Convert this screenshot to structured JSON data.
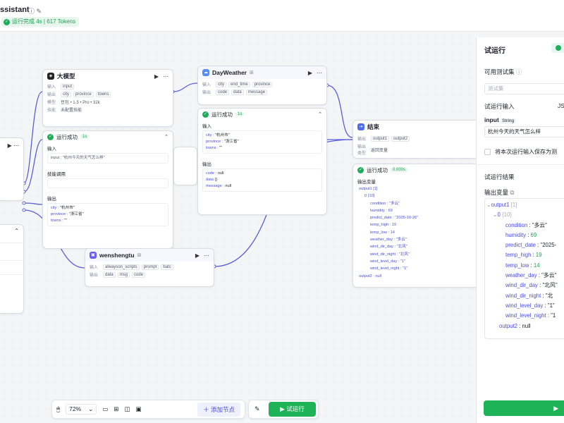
{
  "header": {
    "title": "ssistant",
    "status": "运行完成 4s | 617 Tokens"
  },
  "nodes": {
    "llm": {
      "title": "大模型",
      "input_label": "输入",
      "input": "input",
      "output_label": "输出",
      "outputs": [
        "city",
        "province",
        "towns"
      ],
      "model_label": "模型",
      "model": "豆包 • 1.5 • Pro • 32k",
      "skill_label": "技能",
      "skill": "未配置技能"
    },
    "llm_result": {
      "title": "运行成功",
      "badge": "1s",
      "input_label": "输入",
      "input_line": "input : \"杭州今天的天气怎么样\"",
      "skill_label": "技能调用",
      "output_label": "输出",
      "out": [
        {
          "k": "city",
          "v": "\"杭州市\""
        },
        {
          "k": "province",
          "v": "\"浙江省\""
        },
        {
          "k": "towns",
          "v": "\"\""
        }
      ]
    },
    "weather": {
      "title": "DayWeather",
      "input_label": "输入",
      "inputs": [
        "city",
        "end_time",
        "province"
      ],
      "output_label": "输出",
      "outputs": [
        "code",
        "data",
        "message"
      ]
    },
    "weather_result": {
      "title": "运行成功",
      "badge": "1s",
      "input_label": "输入",
      "in": [
        {
          "k": "city",
          "v": "\"杭州市\""
        },
        {
          "k": "province",
          "v": "\"浙江省\""
        },
        {
          "k": "towns",
          "v": "\"\""
        }
      ],
      "output_label": "输出",
      "out": [
        {
          "k": "code",
          "v": "null"
        },
        {
          "k": "data",
          "v": "{}"
        },
        {
          "k": "message",
          "v": "null"
        }
      ]
    },
    "end": {
      "title": "结束",
      "output_label": "输出",
      "outputs": [
        "output1",
        "output2"
      ],
      "answer_label": "输出类型",
      "answer": "返回变量"
    },
    "end_result": {
      "title": "运行成功",
      "badge": "0.000s",
      "section": "输出变量",
      "lines": [
        "output1 [1]",
        "0 {10}",
        "condition : \"多云\"",
        "humidity : 69",
        "predict_date : \"2025-10-26\"",
        "temp_high : 19",
        "temp_low : 14",
        "weather_day : \"多云\"",
        "wind_dir_day : \"北风\"",
        "wind_dir_night : \"北风\"",
        "wind_level_day : \"1\"",
        "wind_level_night : \"1\"",
        "output2 : null"
      ]
    },
    "wensheng": {
      "title": "wenshengtu",
      "input_label": "输入",
      "inputs": [
        "alwayson_scripts",
        "prompt",
        "batc"
      ],
      "output_label": "输出",
      "outputs": [
        "data",
        "msg",
        "code"
      ]
    }
  },
  "panel": {
    "title": "试运行",
    "testset_label": "可用测试集",
    "testset_placeholder": "测试集",
    "input_section": "试运行输入",
    "input_section_right": "JS",
    "input_name": "input",
    "input_type": "String",
    "input_value": "杭州今天的天气怎么样",
    "save_label": "将本次运行输入保存为测",
    "result_section": "试运行结果",
    "output_label": "输出变量",
    "tree": [
      {
        "indent": 0,
        "k": "output1",
        "v": "[1]",
        "kind": "group"
      },
      {
        "indent": 1,
        "k": "0",
        "v": "{10}",
        "kind": "group"
      },
      {
        "indent": 2,
        "k": "condition",
        "v": "\"多云\"",
        "kind": "str"
      },
      {
        "indent": 2,
        "k": "humidity",
        "v": "69",
        "kind": "num"
      },
      {
        "indent": 2,
        "k": "predict_date",
        "v": "\"2025-",
        "kind": "str"
      },
      {
        "indent": 2,
        "k": "temp_high",
        "v": "19",
        "kind": "num"
      },
      {
        "indent": 2,
        "k": "temp_low",
        "v": "14",
        "kind": "num"
      },
      {
        "indent": 2,
        "k": "weather_day",
        "v": "\"多云\"",
        "kind": "str"
      },
      {
        "indent": 2,
        "k": "wind_dir_day",
        "v": "\"北风\"",
        "kind": "str"
      },
      {
        "indent": 2,
        "k": "wind_dir_night",
        "v": "\"北",
        "kind": "str"
      },
      {
        "indent": 2,
        "k": "wind_level_day",
        "v": "\"1\"",
        "kind": "str"
      },
      {
        "indent": 2,
        "k": "wind_level_night",
        "v": "\"1",
        "kind": "str"
      },
      {
        "indent": 1,
        "k": "output2",
        "v": "null",
        "kind": "str"
      }
    ],
    "run_label": "▶"
  },
  "toolbar": {
    "zoom": "72%",
    "add_node": "添加节点",
    "test_run": "试运行"
  }
}
